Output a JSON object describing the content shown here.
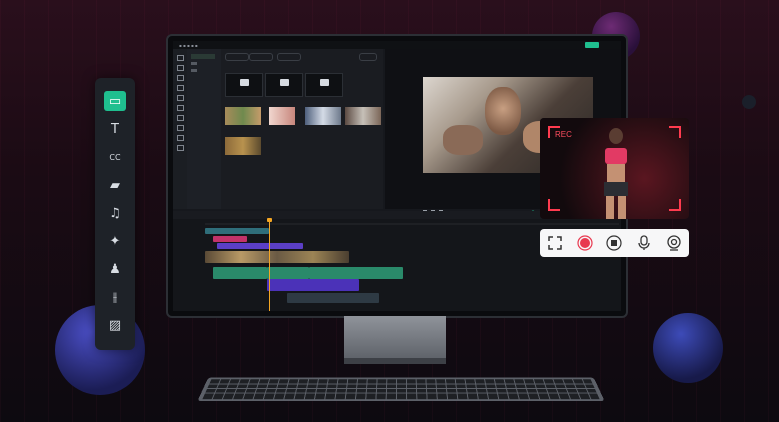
{
  "colors": {
    "accent": "#1fbf8f",
    "record": "#ff3b4f",
    "playhead": "#f5a623"
  },
  "side_toolbar": {
    "items": [
      {
        "name": "media-icon",
        "glyph": "▭"
      },
      {
        "name": "text-icon",
        "glyph": "T"
      },
      {
        "name": "captions-icon",
        "glyph": "CC"
      },
      {
        "name": "folder-icon",
        "glyph": "▰"
      },
      {
        "name": "music-icon",
        "glyph": "♫"
      },
      {
        "name": "effects-icon",
        "glyph": "✦"
      },
      {
        "name": "stickers-icon",
        "glyph": "♟"
      },
      {
        "name": "split-icon",
        "glyph": "⫲"
      },
      {
        "name": "filters-icon",
        "glyph": "▨"
      }
    ]
  },
  "recorder": {
    "label": "REC",
    "controls": [
      {
        "name": "fullscreen-icon",
        "glyph": "⛶"
      },
      {
        "name": "record-icon",
        "glyph": "●"
      },
      {
        "name": "stop-icon",
        "glyph": "◉"
      },
      {
        "name": "microphone-icon",
        "glyph": "🎙"
      },
      {
        "name": "webcam-icon",
        "glyph": "◎"
      }
    ]
  }
}
